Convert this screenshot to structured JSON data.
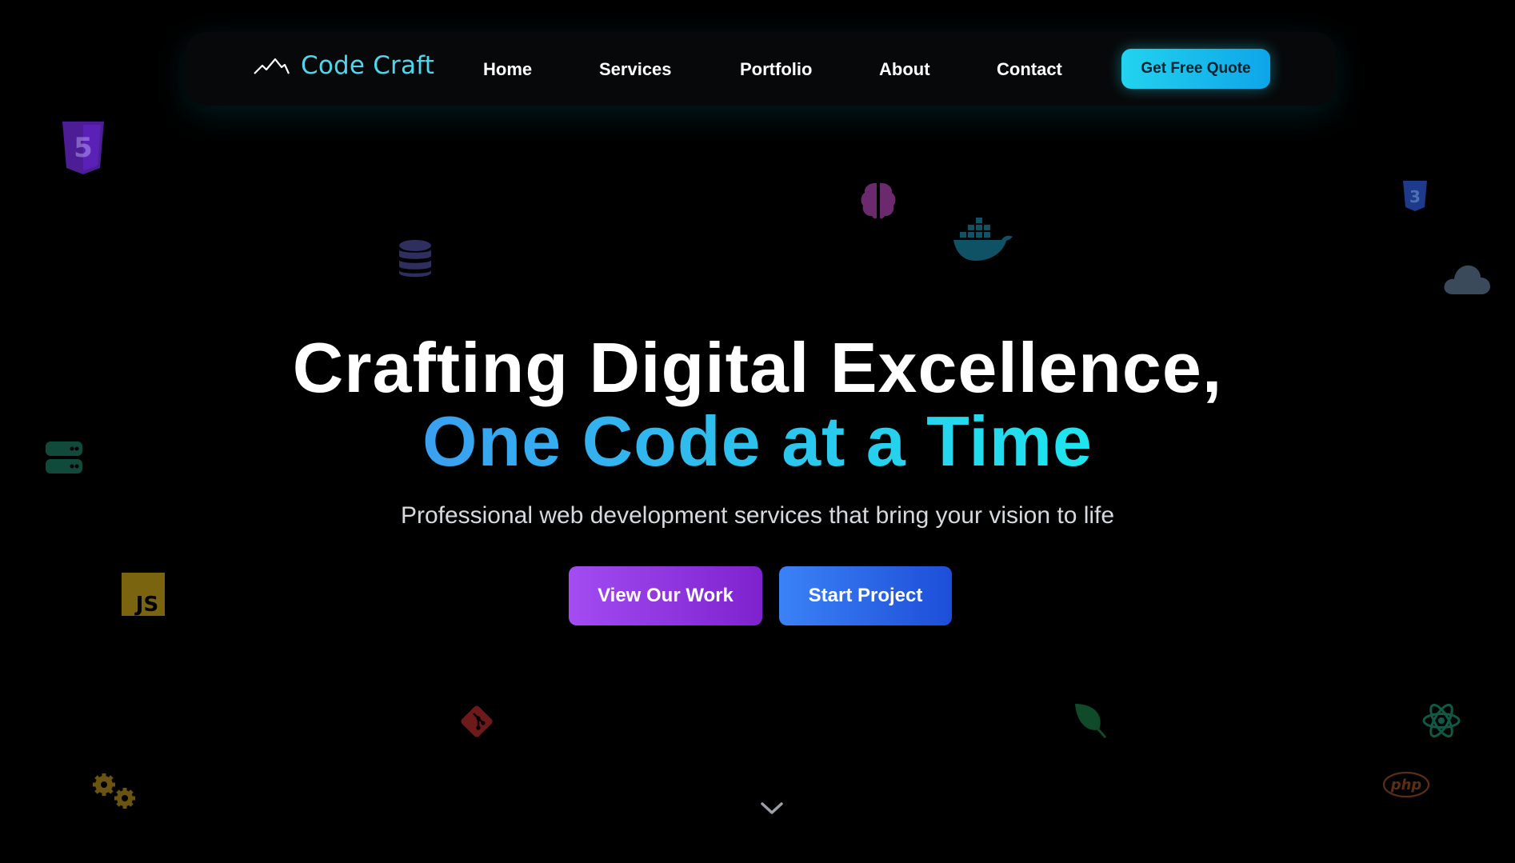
{
  "brand": {
    "name": "Code Craft",
    "logo_icon": "mountain-icon"
  },
  "nav": {
    "links": [
      {
        "label": "Home"
      },
      {
        "label": "Services"
      },
      {
        "label": "Portfolio"
      },
      {
        "label": "About"
      },
      {
        "label": "Contact"
      }
    ],
    "cta_label": "Get Free Quote"
  },
  "hero": {
    "title_line1": "Crafting Digital Excellence,",
    "title_line2": "One Code at a Time",
    "subtitle": "Professional web development services that bring your vision to life",
    "primary_button": "View Our Work",
    "secondary_button": "Start Project",
    "scroll_icon": "chevron-down-icon"
  },
  "floating_icons": [
    {
      "name": "html5-icon",
      "label": "5",
      "color": "#4c1d95"
    },
    {
      "name": "brain-icon",
      "color": "#6b2a6e"
    },
    {
      "name": "docker-icon",
      "color": "#0f5266"
    },
    {
      "name": "css3-icon",
      "label": "3",
      "color": "#1e3a8a"
    },
    {
      "name": "database-icon",
      "color": "#2e2f5e"
    },
    {
      "name": "cloud-icon",
      "color": "#3a4a5a"
    },
    {
      "name": "server-icon",
      "color": "#0f4a3a"
    },
    {
      "name": "javascript-icon",
      "label": "JS",
      "color": "#7a6410"
    },
    {
      "name": "git-icon",
      "color": "#6e1a1a"
    },
    {
      "name": "leaf-icon",
      "color": "#0f4a2a"
    },
    {
      "name": "react-icon",
      "color": "#0f5a45"
    },
    {
      "name": "gears-icon",
      "color": "#6a5410"
    },
    {
      "name": "php-icon",
      "label": "php",
      "color": "#5a2e14"
    }
  ],
  "colors": {
    "background": "#000000",
    "accent_cyan": "#22d3ee",
    "purple": "#9333ea",
    "blue": "#2563eb"
  }
}
